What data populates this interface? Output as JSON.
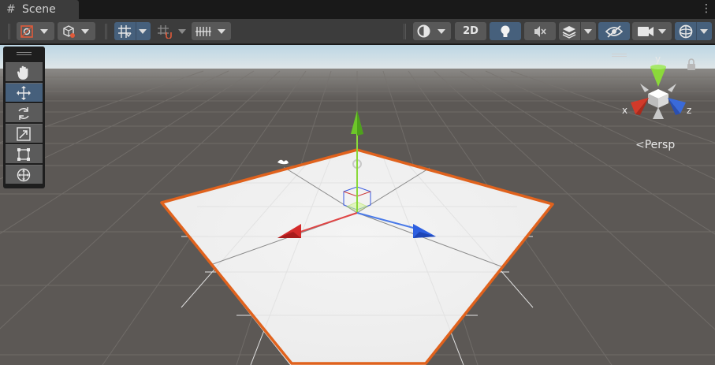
{
  "tab": {
    "title": "Scene",
    "icon": "hash-grid-icon"
  },
  "toolbar": {
    "mode_2d_label": "2D",
    "icons": [
      "draw-mode-icon",
      "render-mode-icon",
      "grid-snap-icon",
      "increment-snap-icon",
      "grid-visibility-icon",
      "shading-icon",
      "lighting-icon",
      "audio-mute-icon",
      "effects-icon",
      "visibility-icon",
      "camera-icon",
      "gizmos-icon"
    ]
  },
  "tools": [
    {
      "name": "hand-tool",
      "icon": "hand-icon",
      "active": false
    },
    {
      "name": "move-tool",
      "icon": "move-icon",
      "active": true
    },
    {
      "name": "rotate-tool",
      "icon": "rotate-icon",
      "active": false
    },
    {
      "name": "scale-tool",
      "icon": "scale-icon",
      "active": false
    },
    {
      "name": "rect-tool",
      "icon": "rect-icon",
      "active": false
    },
    {
      "name": "transform-tool",
      "icon": "transform-icon",
      "active": false
    }
  ],
  "orientation_gizmo": {
    "axes": {
      "x": "x",
      "y": "y",
      "z": "z"
    },
    "projection_label": "Persp",
    "colors": {
      "x": "#d23a2a",
      "y": "#8bd93a",
      "z": "#3a6ad9"
    }
  },
  "scene": {
    "selection_outline_color": "#e0621d",
    "plane_color": "#f0f0f0",
    "ground_color": "#5c5855",
    "sky_color": "#c8dde6"
  }
}
